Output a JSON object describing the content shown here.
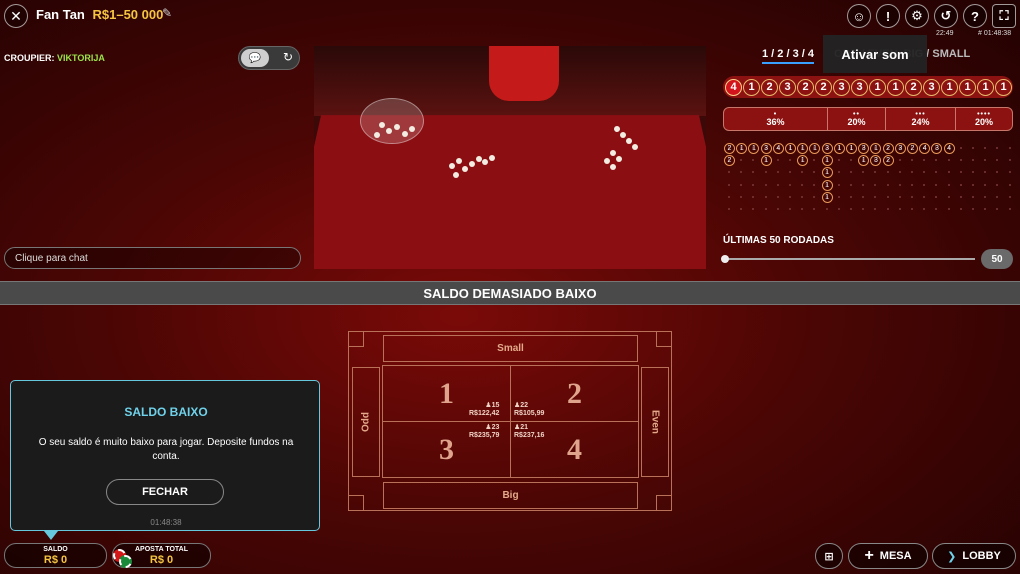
{
  "header": {
    "game_title": "Fan Tan",
    "bet_limits": "R$1–50 000",
    "time_small": "22:49",
    "round_id": "# 01:48:38",
    "tooltip": "Ativar som",
    "icons": [
      "accessibility-icon",
      "info-icon",
      "gear-icon",
      "history-icon",
      "help-icon",
      "fullscreen-icon"
    ]
  },
  "croupier": {
    "label": "CROUPIER:",
    "name": "VIKTORIJA"
  },
  "chat": {
    "placeholder": "Clique para chat"
  },
  "roadmap": {
    "tabs": [
      "1 / 2 / 3 / 4",
      "ODD / EVEN, BIG / SMALL"
    ],
    "last_results": [
      "4",
      "1",
      "2",
      "3",
      "2",
      "2",
      "3",
      "3",
      "1",
      "1",
      "2",
      "3",
      "1",
      "1",
      "1",
      "1"
    ],
    "percentages": [
      {
        "dots": "•",
        "value": "36%"
      },
      {
        "dots": "••",
        "value": "20%"
      },
      {
        "dots": "•••",
        "value": "24%"
      },
      {
        "dots": "••••",
        "value": "20%"
      }
    ],
    "rounds_label": "ÚLTIMAS 50 RODADAS",
    "rounds_value": "50"
  },
  "banner": {
    "text": "SALDO DEMASIADO BAIXO"
  },
  "board": {
    "small": "Small",
    "big": "Big",
    "odd": "Odd",
    "even": "Even",
    "numbers": [
      {
        "n": "1",
        "players": "15",
        "amount": "R$122,42"
      },
      {
        "n": "2",
        "players": "22",
        "amount": "R$105,99"
      },
      {
        "n": "3",
        "players": "23",
        "amount": "R$235,79"
      },
      {
        "n": "4",
        "players": "21",
        "amount": "R$237,16"
      }
    ]
  },
  "modal": {
    "title": "SALDO BAIXO",
    "message": "O seu saldo é muito baixo para jogar. Deposite fundos na conta.",
    "button": "FECHAR",
    "time": "01:48:38"
  },
  "footer": {
    "balance_label": "SALDO",
    "balance_value": "R$ 0",
    "total_bet_label": "APOSTA TOTAL",
    "total_bet_value": "R$ 0",
    "table_button": "MESA",
    "lobby_button": "LOBBY"
  },
  "colors": {
    "accent": "#f5c542",
    "croupier_name": "#9be34a",
    "modal_border": "#66c8dc",
    "modal_title": "#6fd2ea"
  }
}
